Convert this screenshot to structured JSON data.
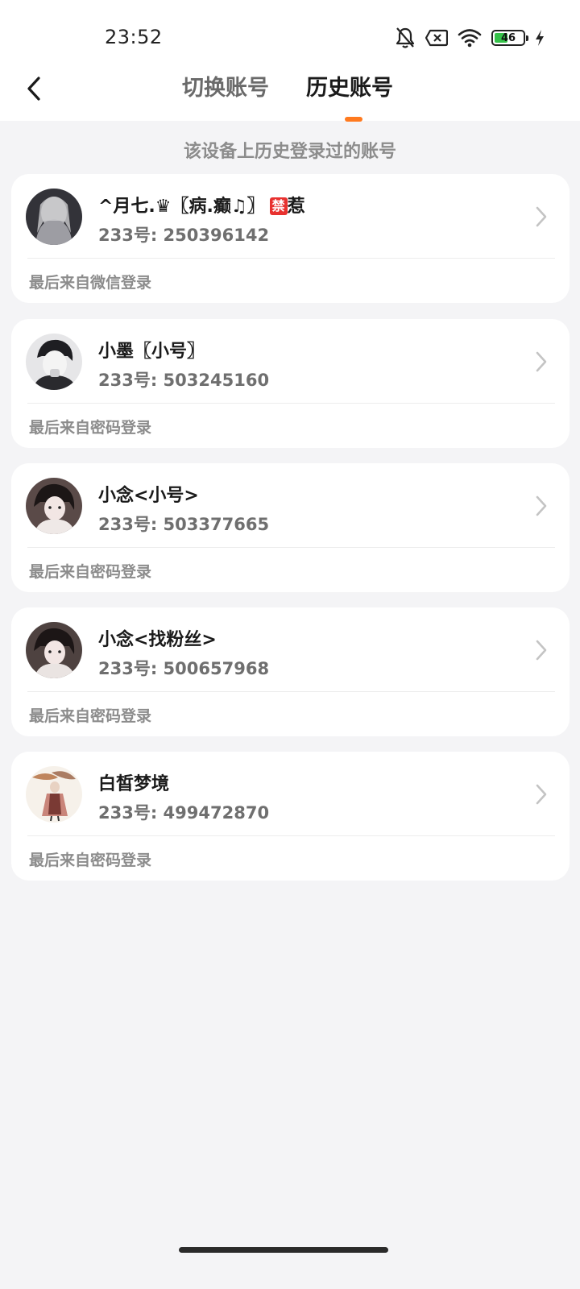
{
  "status_bar": {
    "time": "23:52",
    "icons": [
      "bell-off-icon",
      "close-box-icon",
      "wifi-icon",
      "battery-icon",
      "charging-bolt-icon"
    ],
    "battery_level": "46",
    "battery_fraction": 0.46,
    "battery_color": "#36c24a"
  },
  "header": {
    "back_icon": "chevron-left-icon",
    "tabs": [
      {
        "label": "切换账号",
        "active": false
      },
      {
        "label": "历史账号",
        "active": true
      }
    ],
    "accent_color": "#ff7a1f"
  },
  "subtitle": "该设备上历史登录过的账号",
  "accounts": [
    {
      "name": "^月七.♛〖病.癫♫〗",
      "badge": "禁",
      "name_suffix": "惹",
      "id_label": "233号: 250396142",
      "login_source": "最后来自微信登录"
    },
    {
      "name": "小墨〖小号〗",
      "id_label": "233号: 503245160",
      "login_source": "最后来自密码登录"
    },
    {
      "name": "小念<小号>",
      "id_label": "233号: 503377665",
      "login_source": "最后来自密码登录"
    },
    {
      "name": "小念<找粉丝>",
      "id_label": "233号: 500657968",
      "login_source": "最后来自密码登录"
    },
    {
      "name": "白皙梦境",
      "id_label": "233号: 499472870",
      "login_source": "最后来自密码登录"
    }
  ]
}
